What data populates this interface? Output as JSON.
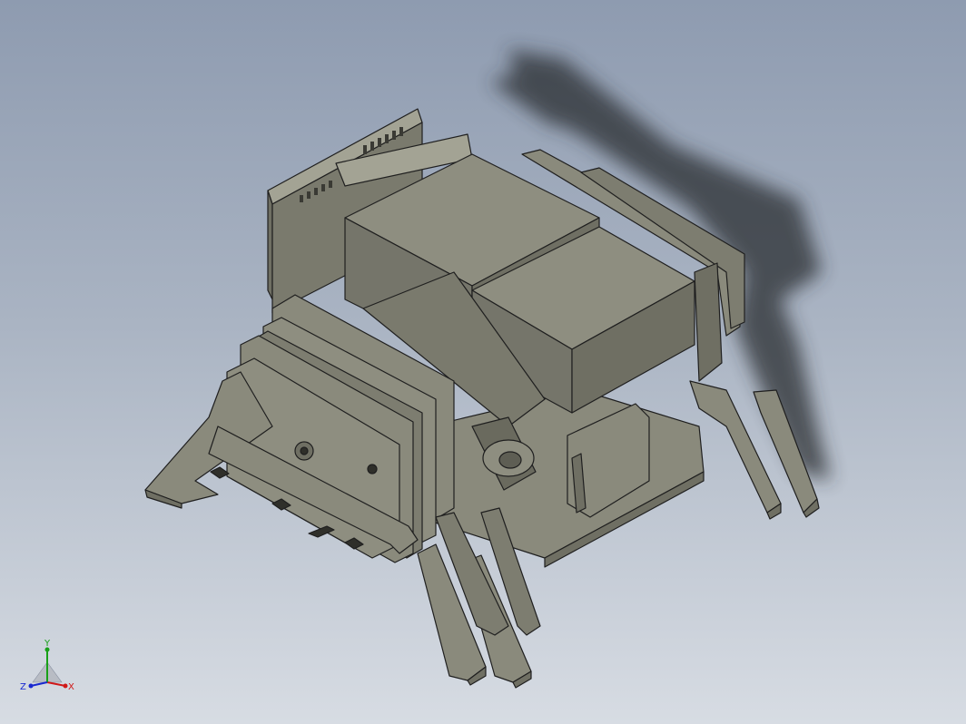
{
  "viewport": {
    "background_top": "#8e9bb0",
    "background_bottom": "#d7dce3",
    "model_color": "#8a8a7c",
    "model_dark": "#6f6f63",
    "model_light": "#a3a394",
    "edge_color": "#1f1f1f",
    "shadow_color": "#2a2d33"
  },
  "triad": {
    "x_label": "X",
    "y_label": "Y",
    "z_label": "Z",
    "x_color": "#d01818",
    "y_color": "#18a018",
    "z_color": "#1828d0"
  }
}
